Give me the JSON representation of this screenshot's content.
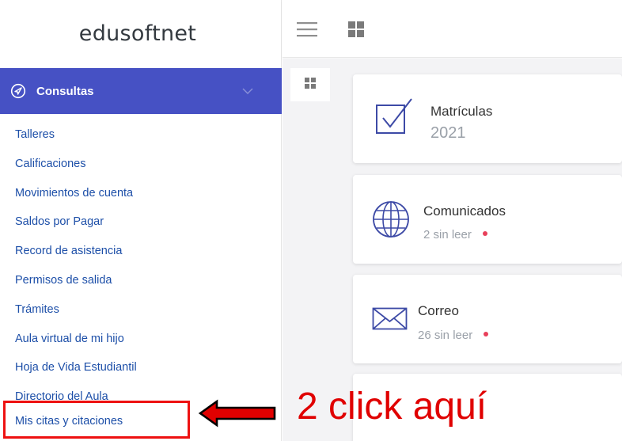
{
  "brand": "edusoftnet",
  "menu": {
    "section_label": "Consultas",
    "section_icon": "navigation-compass-icon",
    "items": [
      "Talleres",
      "Calificaciones",
      "Movimientos de cuenta",
      "Saldos por Pagar",
      "Record de asistencia",
      "Permisos de salida",
      "Trámites",
      "Aula virtual de mi hijo",
      "Hoja de Vida Estudiantil",
      "Directorio del Aula"
    ],
    "highlighted_item": "Mis citas y citaciones"
  },
  "cards": [
    {
      "title": "Matrículas",
      "subtitle": "2021",
      "icon": "checkbox-icon",
      "unread_dot": false
    },
    {
      "title": "Comunicados",
      "subtitle": "2 sin leer",
      "icon": "globe-icon",
      "unread_dot": true
    },
    {
      "title": "Correo",
      "subtitle": "26 sin leer",
      "icon": "mail-envelope-icon",
      "unread_dot": true
    }
  ],
  "annotation": "2 click aquí",
  "colors": {
    "accent": "#4651c4",
    "link": "#1d4fa8",
    "annotation_red": "#e00000",
    "unread_dot": "#e8405a",
    "card_icon": "#3d4aa6"
  }
}
